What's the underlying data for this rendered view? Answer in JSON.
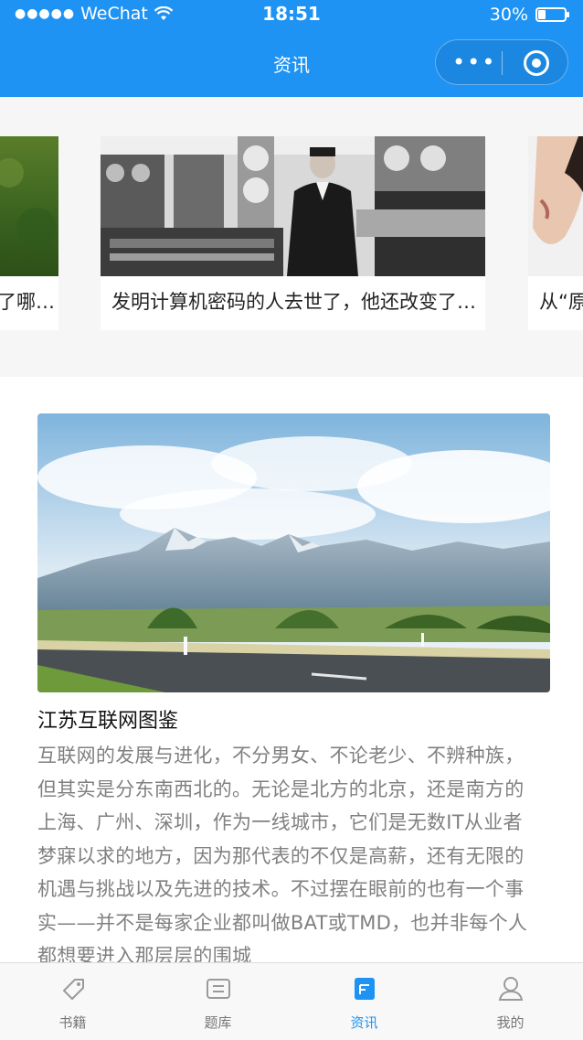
{
  "status_bar": {
    "signal_dots": "●●●●●",
    "carrier": "WeChat",
    "time": "18:51",
    "battery_percent": "30%",
    "battery_level": 0.3
  },
  "nav": {
    "title": "资讯",
    "more_icon": "more-dots-icon",
    "close_icon": "capsule-close-icon"
  },
  "carousel": {
    "items": [
      {
        "caption": "了哪…",
        "image": "green-grass-photo"
      },
      {
        "caption": "发明计算机密码的人去世了，他还改变了…",
        "image": "vintage-computer-room-photo"
      },
      {
        "caption": "从“原",
        "image": "portrait-photo"
      }
    ]
  },
  "article": {
    "image": "mountain-road-landscape-photo",
    "title": "江苏互联网图鉴",
    "body": "互联网的发展与进化，不分男女、不论老少、不辨种族，但其实是分东南西北的。无论是北方的北京，还是南方的上海、广州、深圳，作为一线城市，它们是无数IT从业者梦寐以求的地方，因为那代表的不仅是高薪，还有无限的机遇与挑战以及先进的技术。不过摆在眼前的也有一个事实——并不是每家企业都叫做BAT或TMD，也并非每个人都想要进入那层层的围城"
  },
  "tabbar": {
    "active_color": "#1e93f3",
    "items": [
      {
        "label": "书籍",
        "icon": "tag-icon",
        "active": false
      },
      {
        "label": "题库",
        "icon": "question-bank-icon",
        "active": false
      },
      {
        "label": "资讯",
        "icon": "news-icon",
        "active": true
      },
      {
        "label": "我的",
        "icon": "user-icon",
        "active": false
      }
    ]
  }
}
